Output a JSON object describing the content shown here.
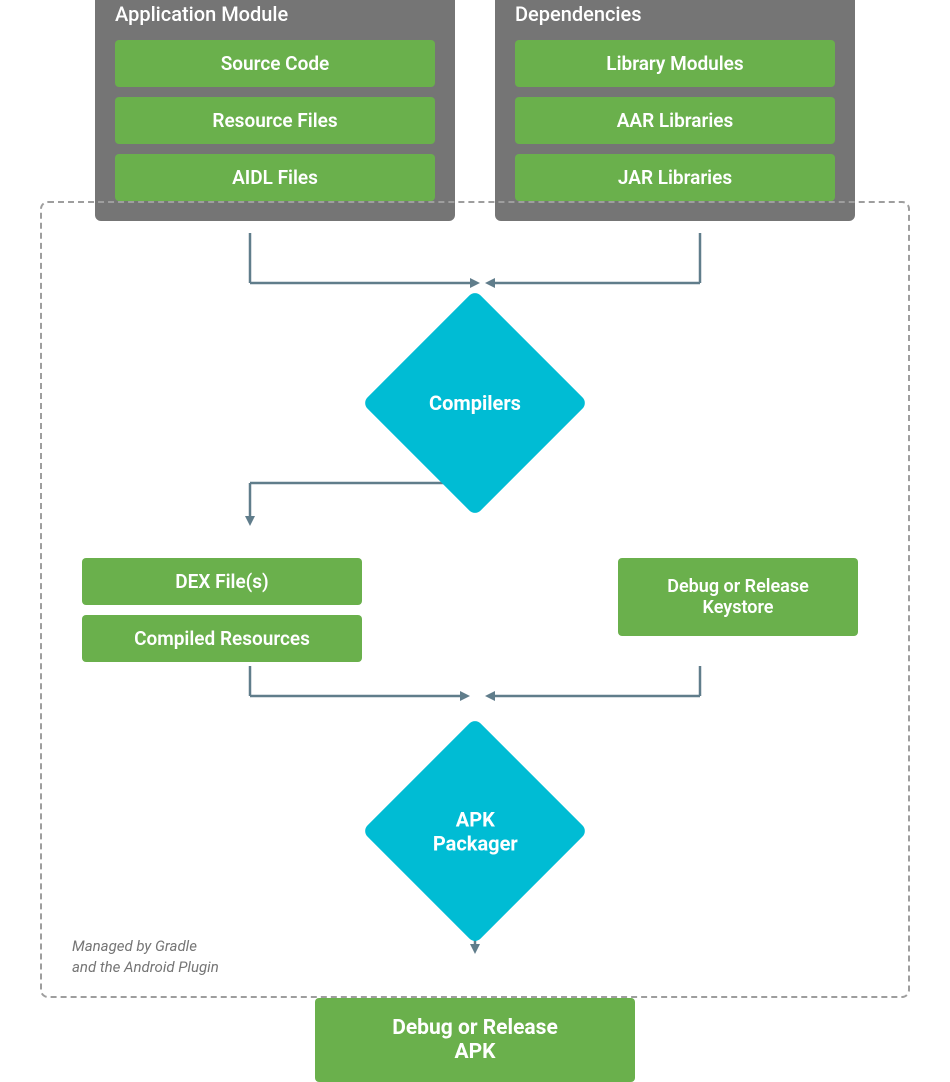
{
  "colors": {
    "green": "#6ab04c",
    "gray": "#757575",
    "cyan": "#00bcd4",
    "dashed": "#9e9e9e",
    "white": "#ffffff",
    "arrow": "#607d8b"
  },
  "appModule": {
    "title": "Application Module",
    "items": [
      "Source Code",
      "Resource Files",
      "AIDL Files"
    ]
  },
  "dependencies": {
    "title": "Dependencies",
    "items": [
      "Library Modules",
      "AAR Libraries",
      "JAR Libraries"
    ]
  },
  "compilers": {
    "label": "Compilers"
  },
  "dexFile": {
    "label": "DEX File(s)"
  },
  "compiledResources": {
    "label": "Compiled Resources"
  },
  "keystore": {
    "label": "Debug or Release\nKeystore"
  },
  "apkPackager": {
    "label": "APK\nPackager"
  },
  "outputApk": {
    "label": "Debug or Release\nAPK"
  },
  "dashedLabel": {
    "line1": "Managed by Gradle",
    "line2": "and the Android Plugin"
  }
}
